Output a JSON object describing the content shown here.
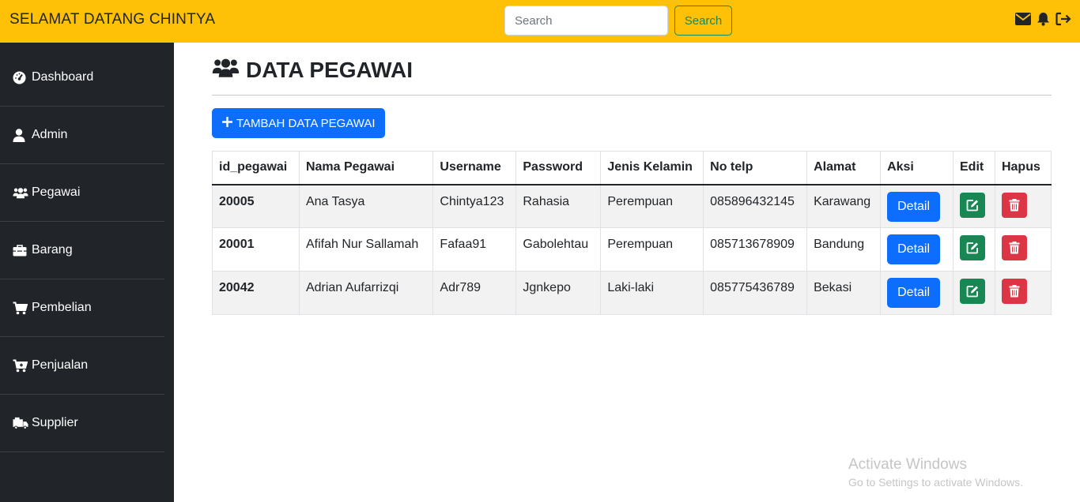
{
  "navbar": {
    "brand": "SELAMAT DATANG CHINTYA",
    "search_placeholder": "Search",
    "search_button": "Search",
    "icons": [
      "envelope-icon",
      "bell-icon",
      "logout-icon"
    ],
    "bg_color": "#ffc107"
  },
  "sidebar": {
    "items": [
      {
        "label": "Dashboard",
        "icon": "dashboard-icon"
      },
      {
        "label": "Admin",
        "icon": "user-icon"
      },
      {
        "label": "Pegawai",
        "icon": "users-icon"
      },
      {
        "label": "Barang",
        "icon": "toolbox-icon"
      },
      {
        "label": "Pembelian",
        "icon": "cart-icon"
      },
      {
        "label": "Penjualan",
        "icon": "cart-plus-icon"
      },
      {
        "label": "Supplier",
        "icon": "truck-icon"
      }
    ]
  },
  "main": {
    "title": "DATA PEGAWAI",
    "add_button": "TAMBAH DATA PEGAWAI",
    "table": {
      "headers": [
        "id_pegawai",
        "Nama Pegawai",
        "Username",
        "Password",
        "Jenis Kelamin",
        "No telp",
        "Alamat",
        "Aksi",
        "Edit",
        "Hapus"
      ],
      "rows": [
        {
          "id": "20005",
          "nama": "Ana Tasya",
          "username": "Chintya123",
          "password": "Rahasia",
          "jk": "Perempuan",
          "telp": "085896432145",
          "alamat": "Karawang",
          "aksi": "Detail"
        },
        {
          "id": "20001",
          "nama": "Afifah Nur Sallamah",
          "username": "Fafaa91",
          "password": "Gabolehtau",
          "jk": "Perempuan",
          "telp": "085713678909",
          "alamat": "Bandung",
          "aksi": "Detail"
        },
        {
          "id": "20042",
          "nama": "Adrian Aufarrizqi",
          "username": "Adr789",
          "password": "Jgnkepo",
          "jk": "Laki-laki",
          "telp": "085775436789",
          "alamat": "Bekasi",
          "aksi": "Detail"
        }
      ]
    }
  },
  "watermark": {
    "line1": "Activate Windows",
    "line2": "Go to Settings to activate Windows."
  }
}
